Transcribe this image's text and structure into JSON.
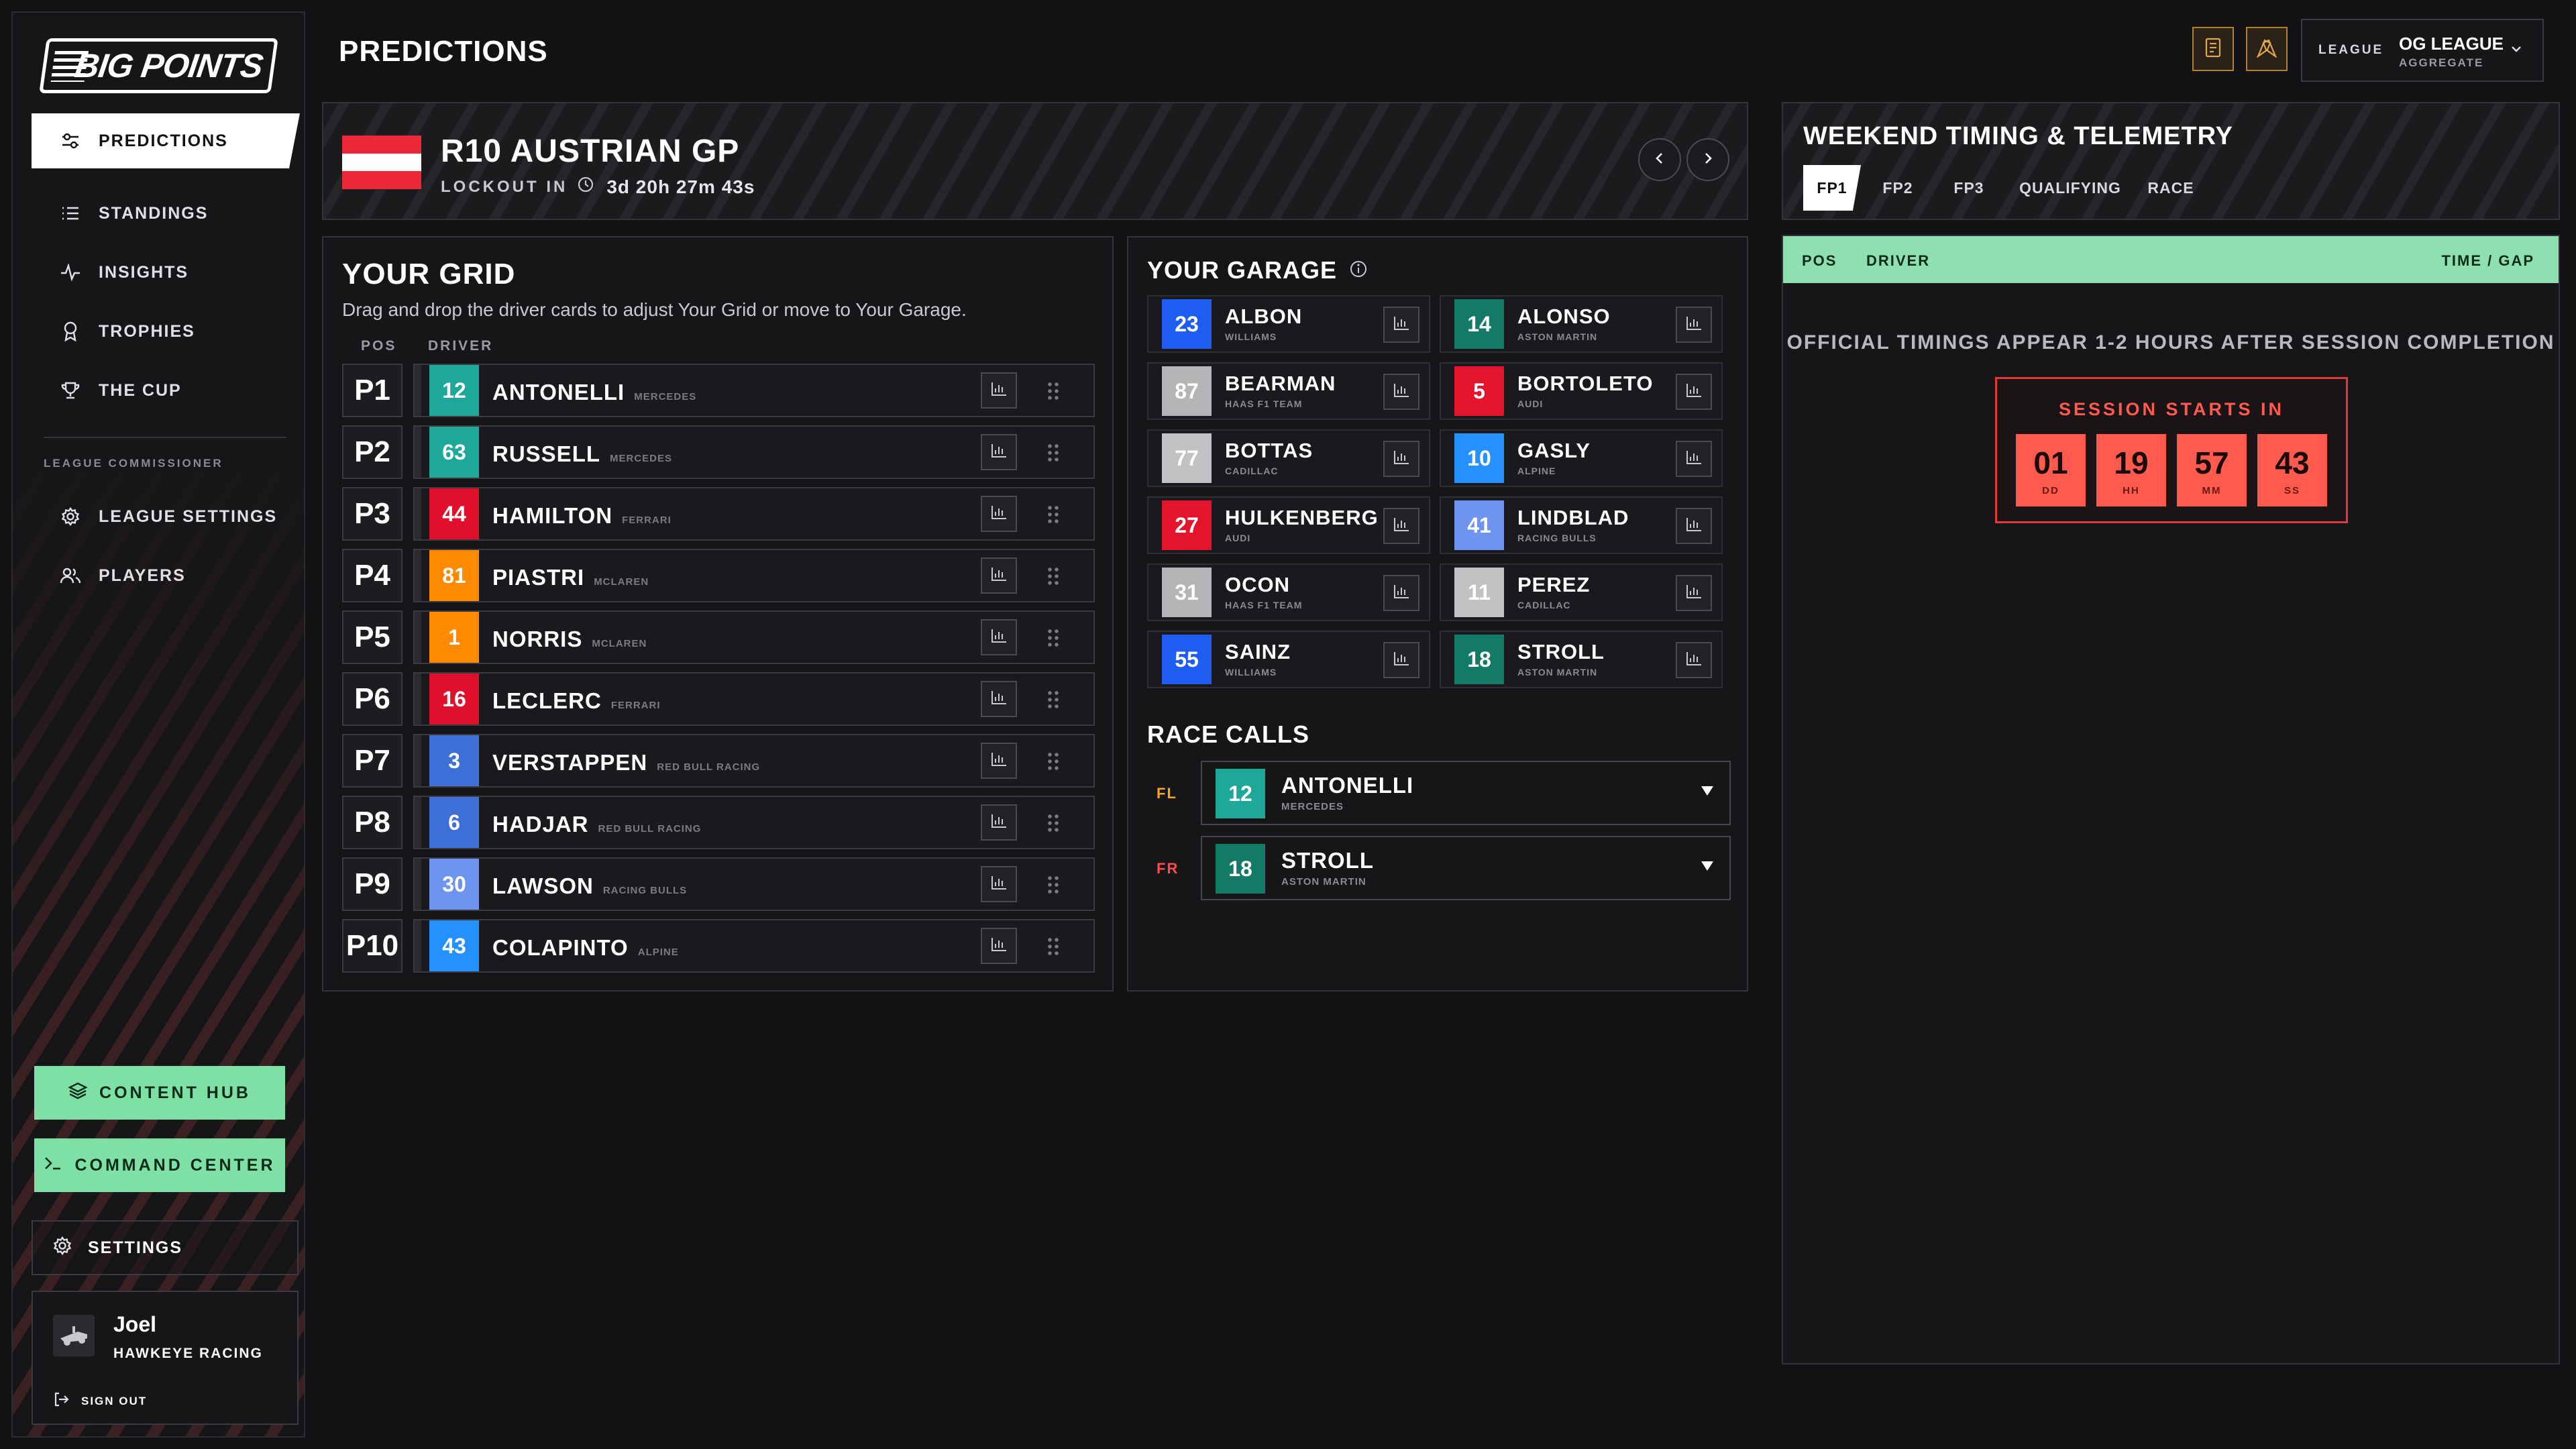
{
  "brand": {
    "logo_text": "BIG POINTS"
  },
  "sidebar": {
    "nav": [
      {
        "label": "PREDICTIONS",
        "icon": "sliders-icon",
        "active": true
      },
      {
        "label": "STANDINGS",
        "icon": "list-ordered-icon"
      },
      {
        "label": "INSIGHTS",
        "icon": "pulse-icon"
      },
      {
        "label": "TROPHIES",
        "icon": "medal-icon"
      },
      {
        "label": "THE CUP",
        "icon": "trophy-icon"
      }
    ],
    "section_label": "LEAGUE COMMISSIONER",
    "commissioner": [
      {
        "label": "LEAGUE SETTINGS",
        "icon": "gear-icon"
      },
      {
        "label": "PLAYERS",
        "icon": "users-icon"
      }
    ],
    "content_hub": "CONTENT HUB",
    "command_center": "COMMAND CENTER",
    "settings": "SETTINGS",
    "user": {
      "name": "Joel",
      "team": "HAWKEYE RACING",
      "sign_out": "SIGN OUT"
    }
  },
  "header": {
    "title": "PREDICTIONS",
    "league_label": "LEAGUE",
    "league_name": "OG LEAGUE",
    "league_sub": "AGGREGATE"
  },
  "race": {
    "title": "R10 AUSTRIAN GP",
    "lockout_label": "LOCKOUT IN",
    "lockout_d": "3",
    "lockout_h": "20",
    "lockout_m": "27",
    "lockout_s": "43",
    "unit_d": "d",
    "unit_h": "h",
    "unit_m": "m",
    "unit_s": "s",
    "flag_colors": [
      "#ed2939",
      "#ffffff",
      "#ed2939"
    ]
  },
  "grid": {
    "title": "YOUR GRID",
    "subtitle": "Drag and drop the driver cards to adjust Your Grid or move to Your Garage.",
    "col_pos": "POS",
    "col_driver": "DRIVER",
    "rows": [
      {
        "pos": "P1",
        "num": "12",
        "name": "ANTONELLI",
        "team": "Mercedes",
        "color": "#1ea89a"
      },
      {
        "pos": "P2",
        "num": "63",
        "name": "RUSSELL",
        "team": "Mercedes",
        "color": "#1ea89a"
      },
      {
        "pos": "P3",
        "num": "44",
        "name": "HAMILTON",
        "team": "Ferrari",
        "color": "#e0102d"
      },
      {
        "pos": "P4",
        "num": "81",
        "name": "PIASTRI",
        "team": "McLaren",
        "color": "#ff8a00"
      },
      {
        "pos": "P5",
        "num": "1",
        "name": "NORRIS",
        "team": "McLaren",
        "color": "#ff8a00"
      },
      {
        "pos": "P6",
        "num": "16",
        "name": "LECLERC",
        "team": "Ferrari",
        "color": "#e0102d"
      },
      {
        "pos": "P7",
        "num": "3",
        "name": "VERSTAPPEN",
        "team": "Red Bull Racing",
        "color": "#3d6fd6"
      },
      {
        "pos": "P8",
        "num": "6",
        "name": "HADJAR",
        "team": "Red Bull Racing",
        "color": "#3d6fd6"
      },
      {
        "pos": "P9",
        "num": "30",
        "name": "LAWSON",
        "team": "Racing Bulls",
        "color": "#6f94f0"
      },
      {
        "pos": "P10",
        "num": "43",
        "name": "COLAPINTO",
        "team": "Alpine",
        "color": "#2590ff"
      }
    ]
  },
  "garage": {
    "title": "YOUR GARAGE",
    "drivers": [
      {
        "num": "23",
        "name": "ALBON",
        "team": "WILLIAMS",
        "color": "#1f5cf2"
      },
      {
        "num": "14",
        "name": "ALONSO",
        "team": "ASTON MARTIN",
        "color": "#137a66"
      },
      {
        "num": "87",
        "name": "BEARMAN",
        "team": "HAAS F1 TEAM",
        "color": "#b5b5b8"
      },
      {
        "num": "5",
        "name": "BORTOLETO",
        "team": "AUDI",
        "color": "#e5142d"
      },
      {
        "num": "77",
        "name": "BOTTAS",
        "team": "CADILLAC",
        "color": "#c2c2c4"
      },
      {
        "num": "10",
        "name": "GASLY",
        "team": "ALPINE",
        "color": "#2592ff"
      },
      {
        "num": "27",
        "name": "HULKENBERG",
        "team": "AUDI",
        "color": "#e5142d"
      },
      {
        "num": "41",
        "name": "LINDBLAD",
        "team": "RACING BULLS",
        "color": "#6f94f0"
      },
      {
        "num": "31",
        "name": "OCON",
        "team": "HAAS F1 TEAM",
        "color": "#b5b5b8"
      },
      {
        "num": "11",
        "name": "PEREZ",
        "team": "CADILLAC",
        "color": "#c2c2c4"
      },
      {
        "num": "55",
        "name": "SAINZ",
        "team": "WILLIAMS",
        "color": "#1f5cf2"
      },
      {
        "num": "18",
        "name": "STROLL",
        "team": "ASTON MARTIN",
        "color": "#137a66"
      }
    ]
  },
  "race_calls": {
    "title": "RACE CALLS",
    "calls": [
      {
        "label": "FL",
        "label_color": "#f5a623",
        "num": "12",
        "name": "ANTONELLI",
        "team": "MERCEDES",
        "color": "#1ea89a"
      },
      {
        "label": "FR",
        "label_color": "#ff4b4b",
        "num": "18",
        "name": "STROLL",
        "team": "ASTON MARTIN",
        "color": "#137a66"
      }
    ]
  },
  "telemetry": {
    "title": "WEEKEND TIMING & TELEMETRY",
    "tabs": [
      "FP1",
      "FP2",
      "FP3",
      "QUALIFYING",
      "RACE"
    ],
    "col_pos": "POS",
    "col_driver": "DRIVER",
    "col_time": "TIME / GAP",
    "note": "OFFICIAL TIMINGS APPEAR 1-2 HOURS AFTER SESSION COMPLETION",
    "countdown_title": "SESSION STARTS IN",
    "countdown": [
      {
        "value": "01",
        "unit": "DD"
      },
      {
        "value": "19",
        "unit": "HH"
      },
      {
        "value": "57",
        "unit": "MM"
      },
      {
        "value": "43",
        "unit": "SS"
      }
    ]
  }
}
